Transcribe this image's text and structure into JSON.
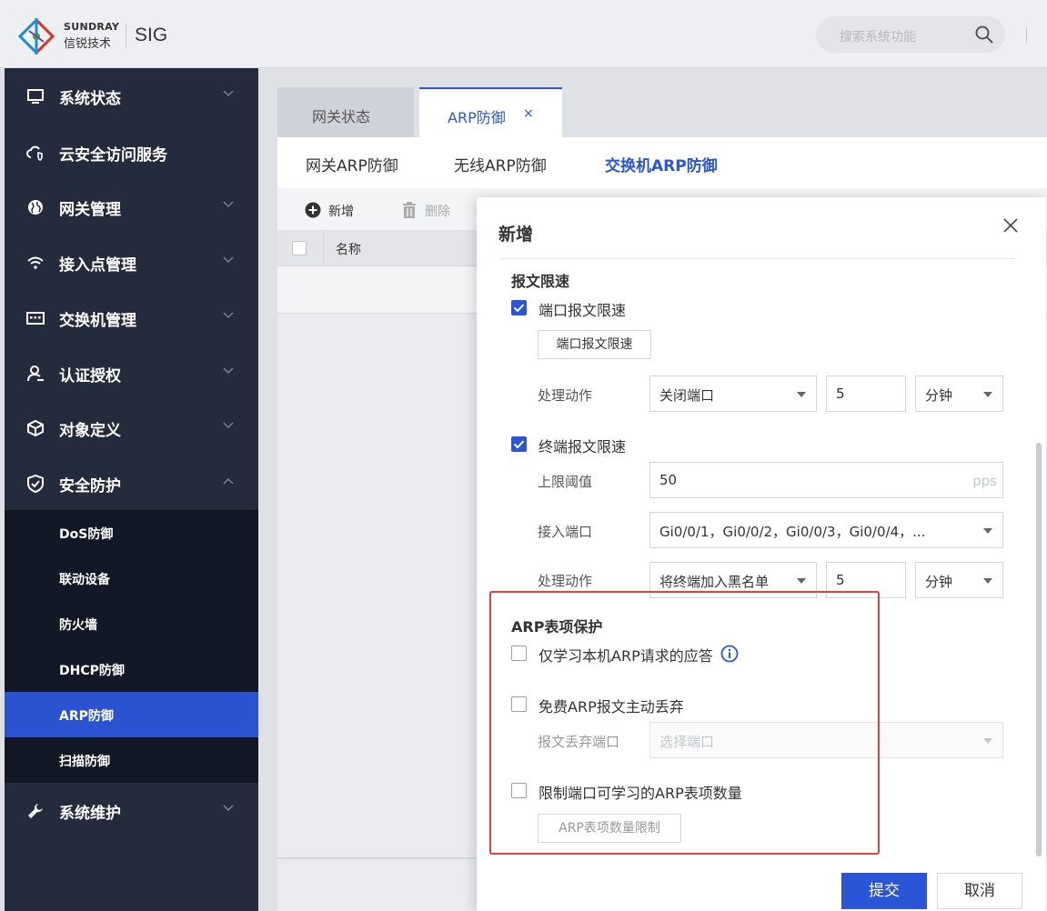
{
  "header": {
    "brand_en": "SUNDRAY",
    "brand_cn": "信锐技术",
    "product": "SIG",
    "search_placeholder": "搜索系统功能"
  },
  "sidebar": {
    "items": [
      {
        "label": "系统状态",
        "icon": "monitor-icon"
      },
      {
        "label": "云安全访问服务",
        "icon": "cloud-shield-icon"
      },
      {
        "label": "网关管理",
        "icon": "globe-icon"
      },
      {
        "label": "接入点管理",
        "icon": "wifi-icon"
      },
      {
        "label": "交换机管理",
        "icon": "switch-icon"
      },
      {
        "label": "认证授权",
        "icon": "user-auth-icon"
      },
      {
        "label": "对象定义",
        "icon": "cube-icon"
      },
      {
        "label": "安全防护",
        "icon": "shield-icon"
      },
      {
        "label": "系统维护",
        "icon": "wrench-icon"
      }
    ],
    "sub_items": [
      "DoS防御",
      "联动设备",
      "防火墙",
      "DHCP防御",
      "ARP防御",
      "扫描防御"
    ],
    "active_sub": "ARP防御"
  },
  "tabs": {
    "gateway_status": "网关状态",
    "arp_defense": "ARP防御",
    "close_symbol": "×"
  },
  "subtabs": [
    "网关ARP防御",
    "无线ARP防御",
    "交换机ARP防御"
  ],
  "toolbar": {
    "add": "新增",
    "delete": "删除"
  },
  "table": {
    "columns": [
      "名称"
    ]
  },
  "modal": {
    "title": "新增",
    "rate_limit": {
      "title": "报文限速",
      "port_check_label": "端口报文限速",
      "port_check": true,
      "port_button": "端口报文限速",
      "action_label": "处理动作",
      "port_action": "关闭端口",
      "port_duration": "5",
      "port_unit": "分钟",
      "terminal_check_label": "终端报文限速",
      "terminal_check": true,
      "threshold_label": "上限阈值",
      "threshold_value": "50",
      "threshold_unit": "pps",
      "ports_label": "接入端口",
      "ports_value": "Gi0/0/1，Gi0/0/2，Gi0/0/3，Gi0/0/4，...",
      "terminal_action": "将终端加入黑名单",
      "terminal_duration": "5",
      "terminal_unit": "分钟"
    },
    "arp_protect": {
      "title": "ARP表项保护",
      "opt1_label": "仅学习本机ARP请求的应答",
      "opt1_check": false,
      "opt2_label": "免费ARP报文主动丢弃",
      "opt2_check": false,
      "drop_port_label": "报文丢弃端口",
      "drop_port_placeholder": "选择端口",
      "opt3_label": "限制端口可学习的ARP表项数量",
      "opt3_check": false,
      "limit_button": "ARP表项数量限制"
    },
    "submit": "提交",
    "cancel": "取消"
  },
  "colors": {
    "accent": "#2a55d6",
    "sidebar_bg": "#242b3d",
    "sidebar_sub_bg": "#131826",
    "highlight": "#e0443d"
  }
}
